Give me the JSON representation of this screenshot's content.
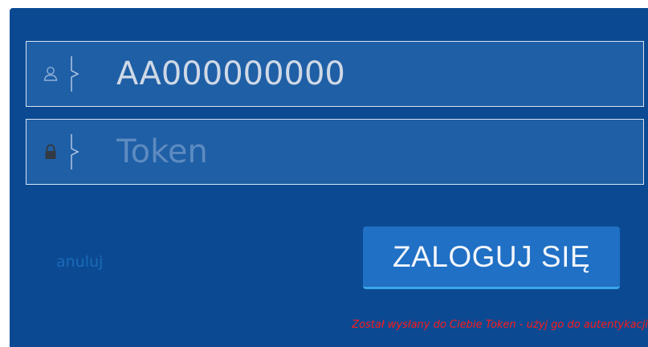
{
  "login_form": {
    "username": {
      "value": "AA000000000",
      "placeholder": "",
      "icon": "user-icon"
    },
    "token": {
      "value": "",
      "placeholder": "Token",
      "icon": "lock-icon"
    },
    "cancel_label": "anuluj",
    "login_label": "ZALOGUJ SIĘ",
    "message": "Został wysłany do Ciebie Token - użyj go do autentykacji"
  },
  "colors": {
    "panel_background": "#0b4a92",
    "field_background": "#1f5fa6",
    "button_background": "#2070c5",
    "button_accent": "#3aa7ea",
    "message_color": "#ff1a1a",
    "cancel_color": "#1b6ab8"
  }
}
